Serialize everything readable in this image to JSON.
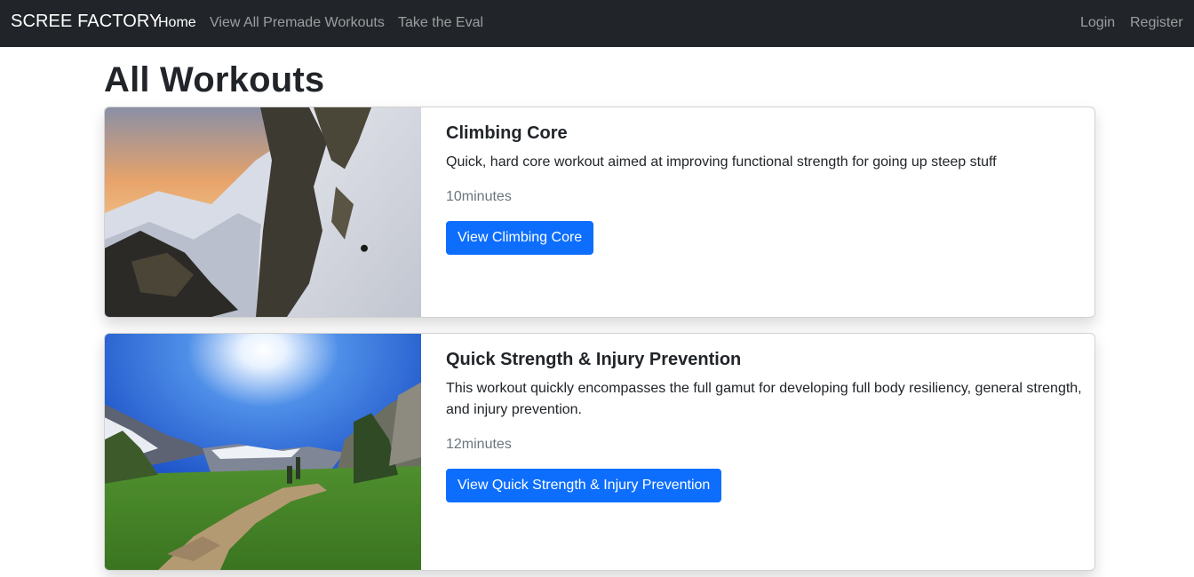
{
  "nav": {
    "brand": "SCREE FACTORY",
    "links": [
      {
        "label": "Home",
        "active": true
      },
      {
        "label": "View All Premade Workouts",
        "active": false
      },
      {
        "label": "Take the Eval",
        "active": false
      }
    ],
    "auth": {
      "login": "Login",
      "register": "Register"
    }
  },
  "page": {
    "title": "All Workouts"
  },
  "workouts": [
    {
      "title": "Climbing Core",
      "description": "Quick, hard core workout aimed at improving functional strength for going up steep stuff",
      "duration": "10minutes",
      "button": "View Climbing Core",
      "image": "snowy mountain couloir at sunset with a skier"
    },
    {
      "title": "Quick Strength & Injury Prevention",
      "description": "This workout quickly encompasses the full gamut for developing full body resiliency, general strength, and injury prevention.",
      "duration": "12minutes",
      "button": "View Quick Strength & Injury Prevention",
      "image": "alpine meadow trail under bright sun and blue sky"
    }
  ],
  "colors": {
    "navbar": "#212529",
    "primary": "#0d6efd",
    "muted": "#6c757d",
    "text": "#212529"
  }
}
